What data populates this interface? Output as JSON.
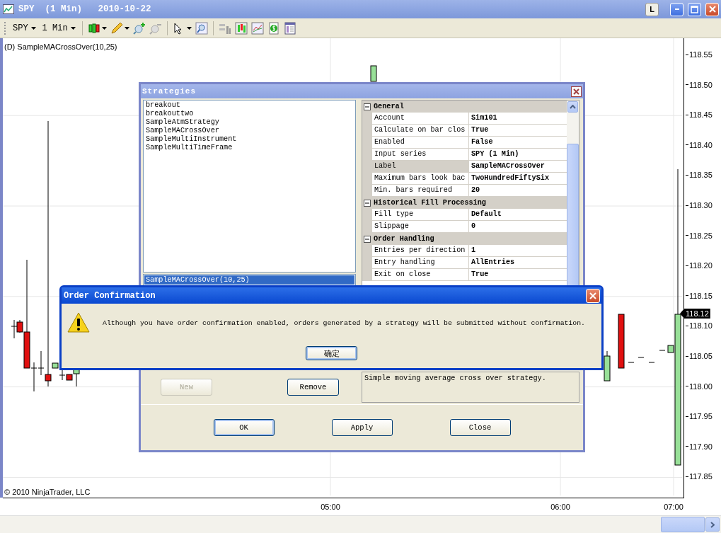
{
  "window": {
    "title": "SPY  (1 Min)   2010-10-22",
    "link_button": "L"
  },
  "toolbar": {
    "instrument": "SPY",
    "interval": "1 Min"
  },
  "chart": {
    "label": "(D) SampleMACrossOver(10,25)",
    "copyright": "© 2010 NinjaTrader, LLC",
    "last_price": "118.12",
    "y_axis_labels": [
      "118.55",
      "118.50",
      "118.45",
      "118.40",
      "118.35",
      "118.30",
      "118.25",
      "118.20",
      "118.15",
      "118.10",
      "118.05",
      "118.00",
      "117.95",
      "117.90",
      "117.85"
    ],
    "x_axis_labels": [
      {
        "label": "05:00",
        "kind": "hour"
      },
      {
        "label": "06:00",
        "kind": "hour"
      },
      {
        "label": "07:00",
        "kind": "hour"
      }
    ]
  },
  "strategies_dialog": {
    "title": "Strategies",
    "available": [
      "breakout",
      "breakouttwo",
      "SampleAtmStrategy",
      "SampleMACrossOver",
      "SampleMultiInstrument",
      "SampleMultiTimeFrame"
    ],
    "configured": [
      {
        "label": "SampleMACrossOver(10,25)",
        "selected": true
      }
    ],
    "properties": [
      {
        "kind": "category",
        "name": "General",
        "expanded": true
      },
      {
        "kind": "property",
        "name": "Account",
        "value": "Sim101",
        "selected": false
      },
      {
        "kind": "property",
        "name": "Calculate on bar clos",
        "value": "True",
        "selected": false
      },
      {
        "kind": "property",
        "name": "Enabled",
        "value": "False",
        "selected": false
      },
      {
        "kind": "property",
        "name": "Input series",
        "value": "SPY (1 Min)",
        "selected": false
      },
      {
        "kind": "property",
        "name": "Label",
        "value": "SampleMACrossOver",
        "selected": true
      },
      {
        "kind": "property",
        "name": "Maximum bars look bac",
        "value": "TwoHundredFiftySix",
        "selected": false
      },
      {
        "kind": "property",
        "name": "Min. bars required",
        "value": "20",
        "selected": false
      },
      {
        "kind": "category",
        "name": "Historical Fill Processing",
        "expanded": true
      },
      {
        "kind": "property",
        "name": "Fill type",
        "value": "Default",
        "selected": false
      },
      {
        "kind": "property",
        "name": "Slippage",
        "value": "0",
        "selected": false
      },
      {
        "kind": "category",
        "name": "Order Handling",
        "expanded": true
      },
      {
        "kind": "property",
        "name": "Entries per direction",
        "value": "1",
        "selected": false
      },
      {
        "kind": "property",
        "name": "Entry handling",
        "value": "AllEntries",
        "selected": false
      },
      {
        "kind": "property",
        "name": "Exit on close",
        "value": "True",
        "selected": false
      }
    ],
    "description": "Simple moving average cross over strategy.",
    "list_buttons": [
      {
        "label": "New",
        "disabled": true
      },
      {
        "label": "Remove",
        "disabled": false
      }
    ],
    "buttons": [
      {
        "label": "OK",
        "default": true
      },
      {
        "label": "Apply",
        "default": false
      },
      {
        "label": "Close",
        "default": false
      }
    ]
  },
  "order_confirmation": {
    "title": "Order Confirmation",
    "message": "Although you have order confirmation enabled, orders generated by a strategy will be submitted without confirmation.",
    "button": "确定"
  }
}
